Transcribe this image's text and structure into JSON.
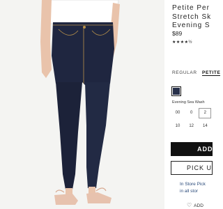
{
  "product": {
    "title_lines": [
      "Petite Per",
      "Stretch Sk",
      "Evening S"
    ],
    "price": "$89",
    "rating_stars": "★★★★½",
    "rating_value": 4.5
  },
  "fit": {
    "options": [
      "REGULAR",
      "PETITE"
    ],
    "selected": "PETITE"
  },
  "color": {
    "name": "Evening Sea Wash",
    "swatch_hex": "#27304a"
  },
  "sizes": {
    "row1": [
      "00",
      "0",
      "2"
    ],
    "row2": [
      "10",
      "12",
      "14"
    ],
    "selected": "2"
  },
  "actions": {
    "add_to_bag": "ADD",
    "pickup": "PICK U",
    "instore_line1": "In Store Pick",
    "instore_line2": "in all stor",
    "wishlist": "ADD"
  },
  "colors": {
    "denim": "#1f2640",
    "skin": "#e9c3ab",
    "shoe": "#e7c2ae",
    "background": "#f4f4f2"
  }
}
